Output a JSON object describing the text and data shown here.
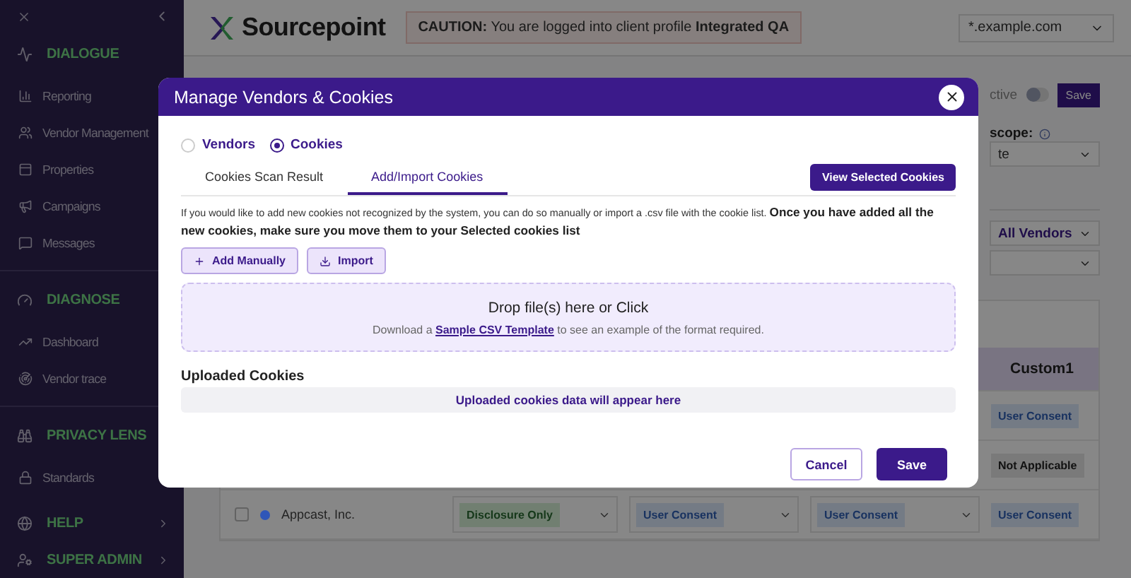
{
  "sidebar": {
    "sections": [
      {
        "title": "DIALOGUE",
        "has_submenu": false,
        "items": [
          {
            "label": "Reporting"
          },
          {
            "label": "Vendor Management"
          },
          {
            "label": "Properties"
          },
          {
            "label": "Campaigns"
          },
          {
            "label": "Messages"
          }
        ]
      },
      {
        "title": "DIAGNOSE",
        "has_submenu": false,
        "items": [
          {
            "label": "Dashboard"
          },
          {
            "label": "Vendor trace"
          }
        ]
      },
      {
        "title": "PRIVACY LENS",
        "has_submenu": false,
        "items": [
          {
            "label": "Standards"
          }
        ]
      },
      {
        "title": "HELP",
        "has_submenu": true
      },
      {
        "title": "SUPER ADMIN",
        "has_submenu": true
      }
    ]
  },
  "header": {
    "logo": "Sourcepoint",
    "caution": "**CAUTION:** You are logged into client profile **Integrated QA**",
    "domain": "*.example.com"
  },
  "settings": {
    "active_label": "ctive",
    "active_on": false,
    "save": "Save",
    "scope_label": "scope:",
    "scope_value": "te",
    "vendor_filter": "All Vendors"
  },
  "table": {
    "custom_column": "Custom1",
    "rows": [
      {
        "cells": [
          null,
          null,
          null,
          {
            "kind": "consent",
            "label": "User Consent"
          }
        ]
      },
      {
        "cells": [
          null,
          null,
          null,
          {
            "kind": "not_applicable",
            "label": "Not Applicable"
          }
        ]
      },
      {
        "name": "Appcast, Inc.",
        "color": "#2f56b8",
        "checked": false,
        "cells": [
          {
            "kind": "disclosure",
            "label": "Disclosure Only"
          },
          {
            "kind": "consent",
            "label": "User Consent"
          },
          {
            "kind": "consent",
            "label": "User Consent"
          },
          {
            "kind": "consent",
            "label": "User Consent"
          }
        ]
      }
    ]
  },
  "modal": {
    "title": "Manage Vendors & Cookies",
    "radios": [
      {
        "label": "Vendors",
        "selected": false
      },
      {
        "label": "Cookies",
        "selected": true
      }
    ],
    "tabs": [
      {
        "label": "Cookies Scan Result",
        "selected": false
      },
      {
        "label": "Add/Import Cookies",
        "selected": true
      }
    ],
    "view_selected": "View Selected Cookies",
    "intro": "If you would like to add new cookies not recognized by the system, you can do so manually or import a .csv file with the cookie list. **Once you have added all the new cookies, make sure you move them to your Selected cookies list**",
    "actions": [
      {
        "kind": "add",
        "label": "Add Manually"
      },
      {
        "kind": "import",
        "label": "Import"
      }
    ],
    "drop_title": "Drop file(s) here or Click",
    "drop_before": "Download a",
    "drop_link": "Sample CSV Template",
    "drop_after": "to see an example of the format required.",
    "uploaded_title": "Uploaded Cookies",
    "uploaded_empty": "Uploaded cookies data will appear here",
    "cancel": "Cancel",
    "save": "Save"
  }
}
